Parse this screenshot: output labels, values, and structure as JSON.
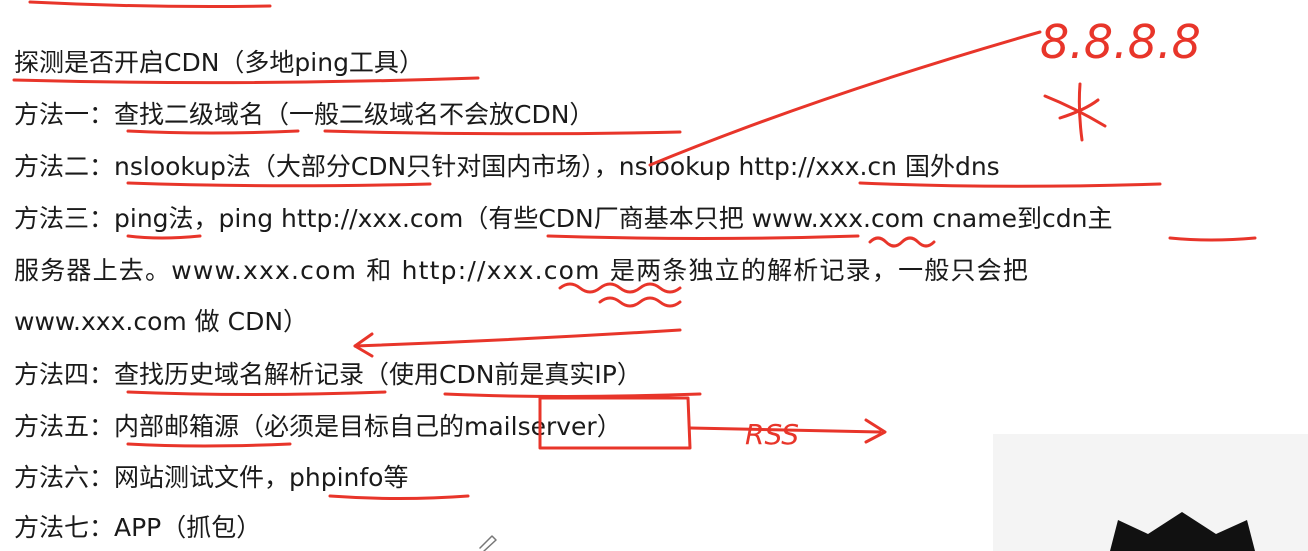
{
  "lines": [
    "探测是否开启CDN（多地ping工具）",
    "方法一：查找二级域名（一般二级域名不会放CDN）",
    "方法二：nslookup法（大部分CDN只针对国内市场），nslookup http://xxx.cn 国外dns",
    "方法三：ping法，ping http://xxx.com（有些CDN厂商基本只把 www.xxx.com cname到cdn主",
    "服务器上去。www.xxx.com 和  http://xxx.com 是两条独立的解析记录，一般只会把",
    "www.xxx.com 做 CDN）",
    "方法四：查找历史域名解析记录（使用CDN前是真实IP）",
    "方法五：内部邮箱源（必须是目标自己的mailserver）",
    "方法六：网站测试文件，phpinfo等",
    "方法七：APP（抓包）"
  ],
  "annotations": {
    "dns_note": "8.8.8.8",
    "mail_note": "RSS"
  },
  "colors": {
    "ink": "#e8352a",
    "text": "#1a1a1a",
    "background": "#ffffff"
  }
}
